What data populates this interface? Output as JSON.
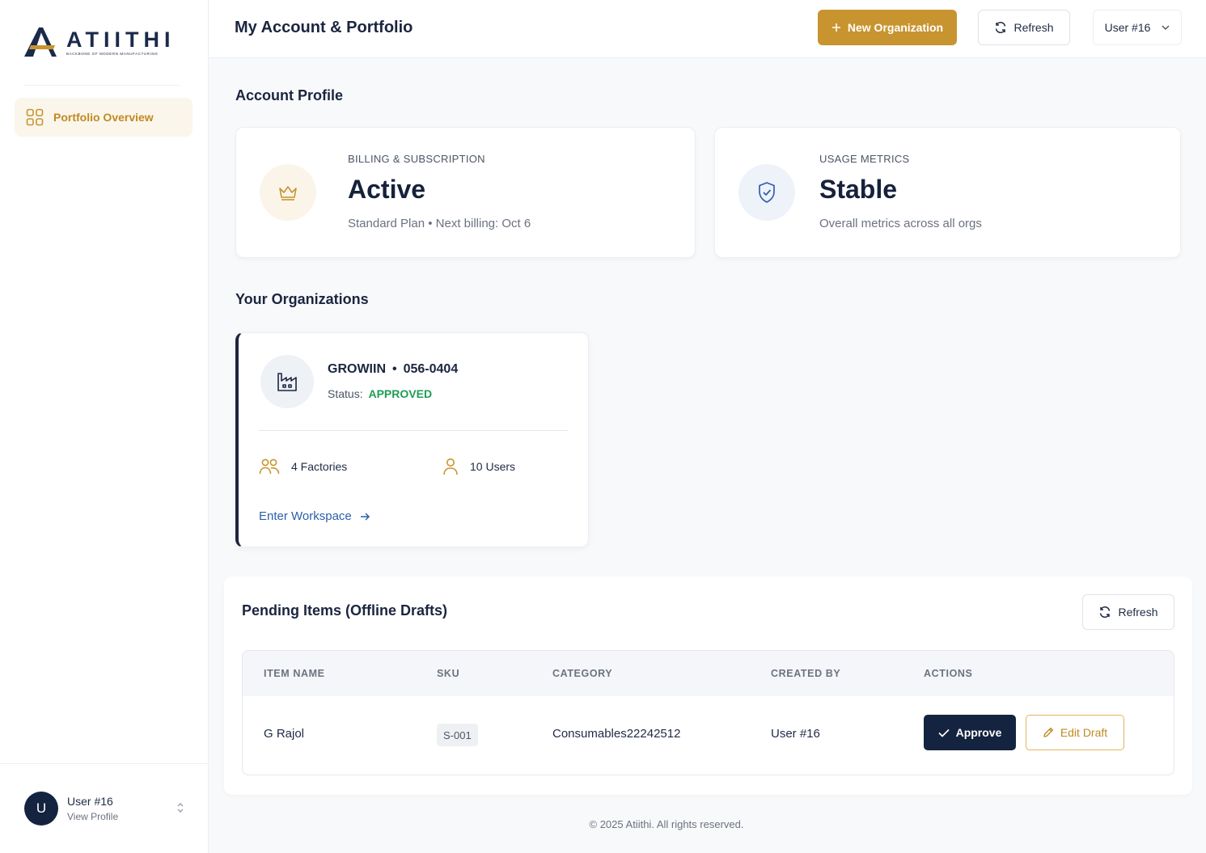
{
  "brand": {
    "name": "ATIITHI",
    "tagline": "BACKBONE OF MODERN MANUFACTURING",
    "accent": "#c8942f",
    "navy": "#14233f"
  },
  "sidebar": {
    "nav": [
      {
        "label": "Portfolio Overview",
        "icon": "grid-icon",
        "active": true
      }
    ],
    "profile": {
      "initial": "U",
      "name": "User #16",
      "sub": "View Profile"
    }
  },
  "header": {
    "title": "My Account & Portfolio",
    "new_org_label": "New Organization",
    "refresh_label": "Refresh",
    "user_label": "User #16"
  },
  "account_profile": {
    "title": "Account Profile",
    "billing": {
      "label": "BILLING & SUBSCRIPTION",
      "value": "Active",
      "sub": "Standard Plan • Next billing: Oct 6",
      "icon": "crown-icon"
    },
    "usage": {
      "label": "USAGE METRICS",
      "value": "Stable",
      "sub": "Overall metrics across all orgs",
      "icon": "shield-check-icon"
    }
  },
  "organizations": {
    "title": "Your Organizations",
    "items": [
      {
        "name": "GROWIIN",
        "code": "056-0404",
        "status_label": "Status:",
        "status": "APPROVED",
        "factories": "4 Factories",
        "users": "10 Users",
        "link": "Enter Workspace"
      }
    ]
  },
  "pending": {
    "title": "Pending Items (Offline Drafts)",
    "refresh_label": "Refresh",
    "columns": [
      "ITEM NAME",
      "SKU",
      "CATEGORY",
      "CREATED BY",
      "ACTIONS"
    ],
    "rows": [
      {
        "item_name": "G Rajol",
        "sku": "S-001",
        "category": "Consumables22242512",
        "created_by": "User #16",
        "approve_label": "Approve",
        "edit_label": "Edit Draft"
      }
    ]
  },
  "footer": {
    "text": "© 2025 Atiithi. All rights reserved."
  }
}
